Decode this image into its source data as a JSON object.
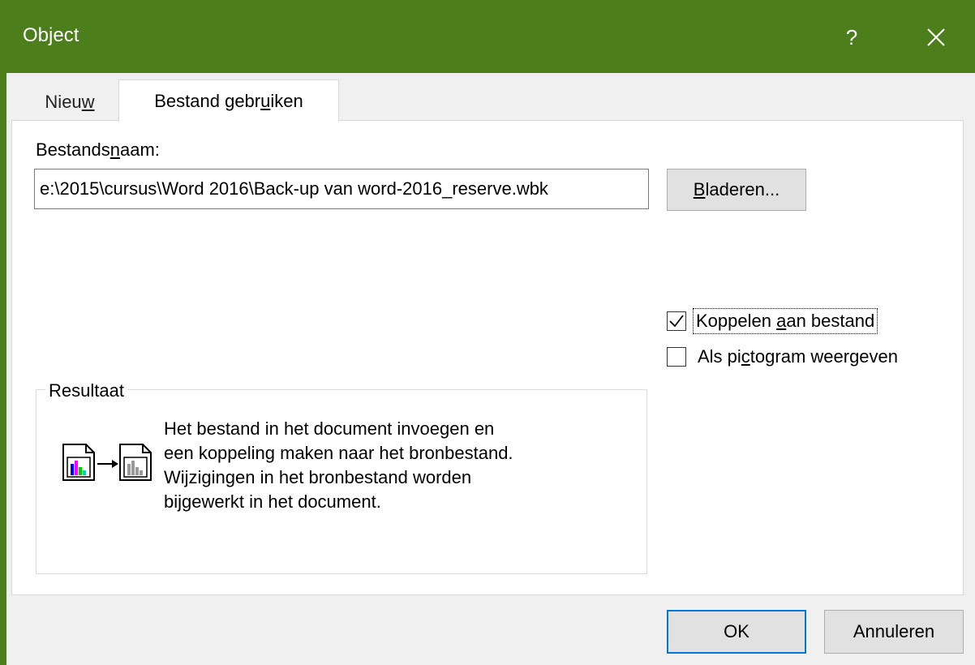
{
  "window": {
    "title": "Object",
    "help": "?"
  },
  "tabs": [
    {
      "label_prefix": "Nieu",
      "label_underline": "w",
      "label_suffix": ""
    },
    {
      "label_prefix": "Bestand gebr",
      "label_underline": "u",
      "label_suffix": "iken"
    }
  ],
  "file": {
    "label_prefix": "Bestands",
    "label_underline": "n",
    "label_suffix": "aam:",
    "path": "e:\\2015\\cursus\\Word 2016\\Back-up van word-2016_reserve.wbk",
    "browse_underline": "B",
    "browse_suffix": "laderen..."
  },
  "options": {
    "link": {
      "prefix": "Koppelen ",
      "underline": "a",
      "suffix": "an bestand",
      "checked": true
    },
    "icon": {
      "prefix": "Als pi",
      "underline": "c",
      "suffix": "togram weergeven",
      "checked": false
    }
  },
  "result": {
    "label": "Resultaat",
    "line1": "Het bestand in het document invoegen en",
    "line2": "een koppeling maken naar het bronbestand.",
    "line3": "Wijzigingen in het bronbestand worden",
    "line4": "bijgewerkt in het document."
  },
  "buttons": {
    "ok": "OK",
    "cancel": "Annuleren"
  }
}
